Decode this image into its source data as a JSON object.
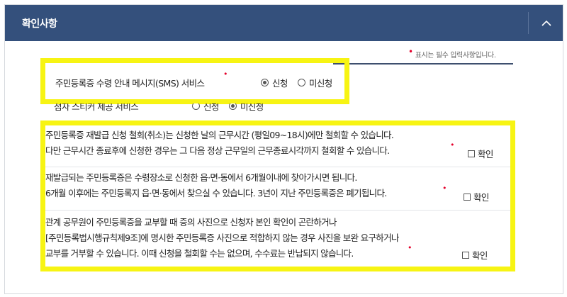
{
  "header": {
    "title": "확인사항",
    "toggle_icon": "chevron-up-icon"
  },
  "required_note": {
    "marker": "•",
    "text": "표시는 필수 입력사항입니다."
  },
  "sms_service": {
    "label": "주민등록증 수령 안내 메시지(SMS) 서비스",
    "required_marker": "•",
    "options": [
      {
        "label": "신청",
        "selected": true
      },
      {
        "label": "미신청",
        "selected": false
      }
    ]
  },
  "braille_service": {
    "label": "점자 스티커 제공 서비스",
    "required_marker": "•",
    "options": [
      {
        "label": "신청",
        "selected": false
      },
      {
        "label": "미신청",
        "selected": true
      }
    ]
  },
  "notices": [
    {
      "lines": [
        "주민등록증 재발급 신청 철회(취소)는 신청한 날의 근무시간 (평일09~18시)에만 철회할 수 있습니다.",
        "다만 근무시간 종료후에 신청한 경우는 그 다음 정상 근무일의 근무종료시각까지 철회할 수 있습니다."
      ],
      "required_marker": "•",
      "confirm_label": "확인"
    },
    {
      "lines": [
        "재발급되는 주민등록증은 수령장소로 신청한 읍·면·동에서 6개월이내에 찾아가시면 됩니다.",
        "6개월 이후에는 주민등록지 읍·면·동에서 찾으실 수 있습니다. 3년이 지난 주민등록증은 폐기됩니다."
      ],
      "required_marker": "•",
      "confirm_label": "확인"
    },
    {
      "lines": [
        "관계 공무원이 주민등록증을 교부할 때 증의 사진으로 신청자 본인 확인이 곤란하거나",
        "[주민등록법시행규칙제9조]에 명시한 주민등록증 사진으로 적합하지 않는 경우 사진을 보완 요구하거나",
        "교부를 거부할 수 있습니다. 이때 신청을 철회할 수는 없으며, 수수료는 반납되지 않습니다."
      ],
      "required_marker": "•",
      "confirm_label": "확인"
    }
  ],
  "colors": {
    "header_bg": "#34507c",
    "highlight": "#f7f413",
    "required": "#e4002b"
  }
}
